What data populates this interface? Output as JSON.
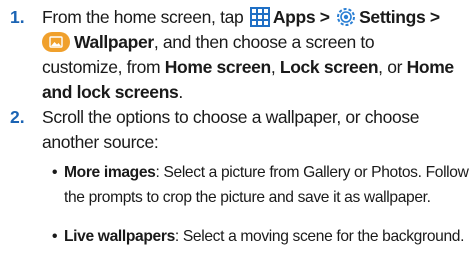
{
  "steps": [
    {
      "number": "1.",
      "t1": "From the home screen, tap ",
      "apps": "Apps >",
      "settings": "Settings >",
      "wallpaper": "Wallpaper",
      "t2": ", and then choose a screen to",
      "t3": "customize, from ",
      "home": "Home screen",
      "c1": ", ",
      "lock": "Lock screen",
      "c2": ", or ",
      "home_and_lock_1": "Home",
      "home_and_lock_2": "and lock screens",
      "end": "."
    },
    {
      "number": "2.",
      "line1": "Scroll the options to choose a wallpaper, or choose",
      "line2": "another source:"
    }
  ],
  "bullets": [
    {
      "marker": "•",
      "term": "More images",
      "desc1": ": Select a picture from Gallery or Photos. Follow",
      "desc2": "the prompts to crop the picture and save it as wallpaper."
    },
    {
      "marker": "•",
      "term": "Live wallpapers",
      "desc1": ": Select a moving scene for the background."
    }
  ],
  "colors": {
    "step_number": "#1b64b4",
    "apps_icon": "#1f6fc5",
    "settings_icon": "#2a7fd4",
    "wallpaper_icon": "#f0a02c"
  },
  "icons": [
    "apps-grid-icon",
    "settings-gear-icon",
    "wallpaper-app-icon"
  ]
}
